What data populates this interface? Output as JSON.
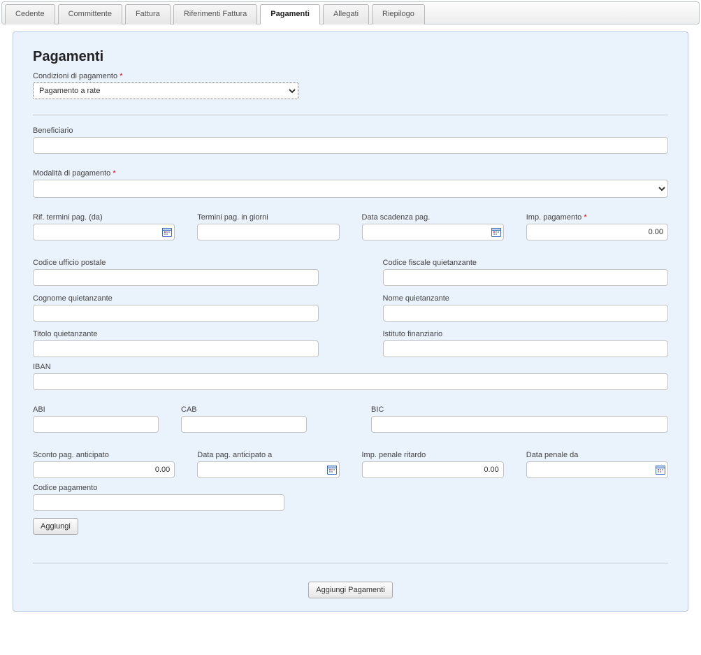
{
  "tabs": {
    "cedente": "Cedente",
    "committente": "Committente",
    "fattura": "Fattura",
    "rif_fattura": "Riferimenti Fattura",
    "pagamenti": "Pagamenti",
    "allegati": "Allegati",
    "riepilogo": "Riepilogo"
  },
  "title": "Pagamenti",
  "labels": {
    "condizioni": "Condizioni di pagamento",
    "beneficiario": "Beneficiario",
    "modalita": "Modalità di pagamento",
    "rif_termini": "Rif. termini pag. (da)",
    "termini_giorni": "Termini pag. in giorni",
    "data_scadenza": "Data scadenza pag.",
    "imp_pagamento": "Imp. pagamento",
    "codice_ufficio": "Codice ufficio postale",
    "cf_quiet": "Codice fiscale quietanzante",
    "cognome_quiet": "Cognome quietanzante",
    "nome_quiet": "Nome quietanzante",
    "titolo_quiet": "Titolo quietanzante",
    "istituto": "Istituto finanziario",
    "iban": "IBAN",
    "abi": "ABI",
    "cab": "CAB",
    "bic": "BIC",
    "sconto_anticipato": "Sconto pag. anticipato",
    "data_anticipato": "Data pag. anticipato a",
    "imp_penale": "Imp. penale ritardo",
    "data_penale": "Data penale da",
    "codice_pagamento": "Codice pagamento"
  },
  "values": {
    "condizioni_selected": "Pagamento a rate",
    "beneficiario": "",
    "modalita_selected": "",
    "rif_termini": "",
    "termini_giorni": "",
    "data_scadenza": "",
    "imp_pagamento": "0.00",
    "codice_ufficio": "",
    "cf_quiet": "",
    "cognome_quiet": "",
    "nome_quiet": "",
    "titolo_quiet": "",
    "istituto": "",
    "iban": "",
    "abi": "",
    "cab": "",
    "bic": "",
    "sconto_anticipato": "0.00",
    "data_anticipato": "",
    "imp_penale": "0.00",
    "data_penale": "",
    "codice_pagamento": ""
  },
  "buttons": {
    "aggiungi": "Aggiungi",
    "aggiungi_pagamenti": "Aggiungi Pagamenti"
  }
}
